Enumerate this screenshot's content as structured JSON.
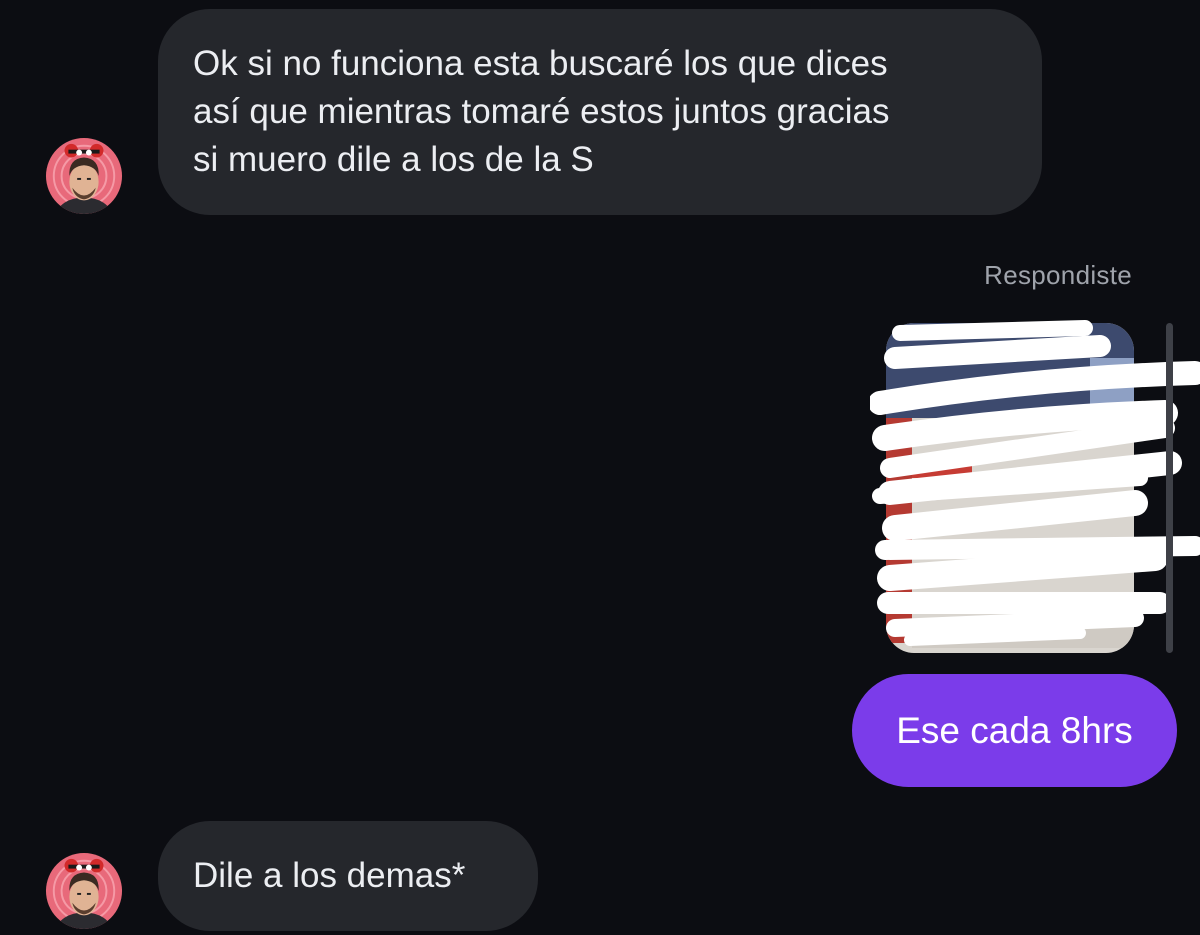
{
  "messages": {
    "incoming_1": {
      "lines": [
        "Ok si no funciona esta buscaré los que dices",
        "así que mientras tomaré estos juntos gracias",
        "si muero dile a los de la S"
      ]
    },
    "reply": {
      "label": "Respondiste",
      "text": "Ese cada 8hrs"
    },
    "incoming_2": {
      "text": "Dile a los demas*"
    }
  },
  "colors": {
    "background": "#0c0d12",
    "incoming_bubble": "#25272c",
    "outgoing_bubble": "#7b3cea",
    "avatar_ring": "#e8697a"
  },
  "icons": {
    "avatar": "avatar-icon",
    "scribbled_image": "redacted-photo"
  }
}
